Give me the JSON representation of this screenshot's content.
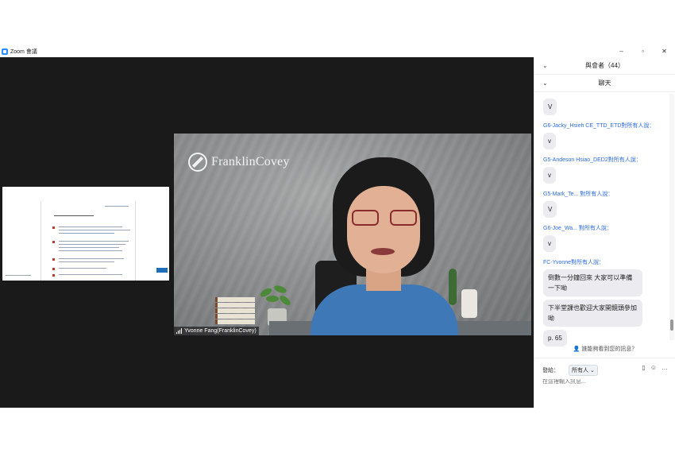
{
  "window": {
    "title": "Zoom 會議",
    "controls": [
      "–",
      "▫",
      "✕"
    ]
  },
  "video": {
    "brand": "FranklinCovey",
    "participant_name": "Yvonne Fang(FranklinCovey)"
  },
  "panel": {
    "participants_label": "與會者（44）",
    "chat_label": "聊天",
    "who_can_see": "誰能夠看到您的訊息？",
    "send_to_label": "發給：",
    "send_to_value": "所有人",
    "input_placeholder": "在這裡輸入訊息..."
  },
  "chat": {
    "messages": [
      {
        "sender": "",
        "text": "V"
      },
      {
        "sender": "G6-Jacky_Hsieh CE_TTD_ETD",
        "suffix": "對所有人說：",
        "text": "v"
      },
      {
        "sender": "G5-Andeson Hsiao_DED2",
        "suffix": "對所有人說：",
        "text": "v"
      },
      {
        "sender": "G5-Mark_Te...",
        "suffix": " 對所有人說：",
        "text": "V"
      },
      {
        "sender": "G6-Joe_Wa...",
        "suffix": " 對所有人說：",
        "text": "v"
      },
      {
        "sender": "FC-Yvonne",
        "suffix": "對所有人說：",
        "text": "倒數一分鐘回來 大家可以準備一下呦"
      },
      {
        "sender": "",
        "text": "下半堂課也歡迎大家開鏡頭參加呦"
      },
      {
        "sender": "",
        "text": "p. 65"
      }
    ]
  },
  "colors": {
    "accent": "#2d8cff",
    "sender_name": "#2d6cdf",
    "stage_bg": "#1a1a1a"
  }
}
